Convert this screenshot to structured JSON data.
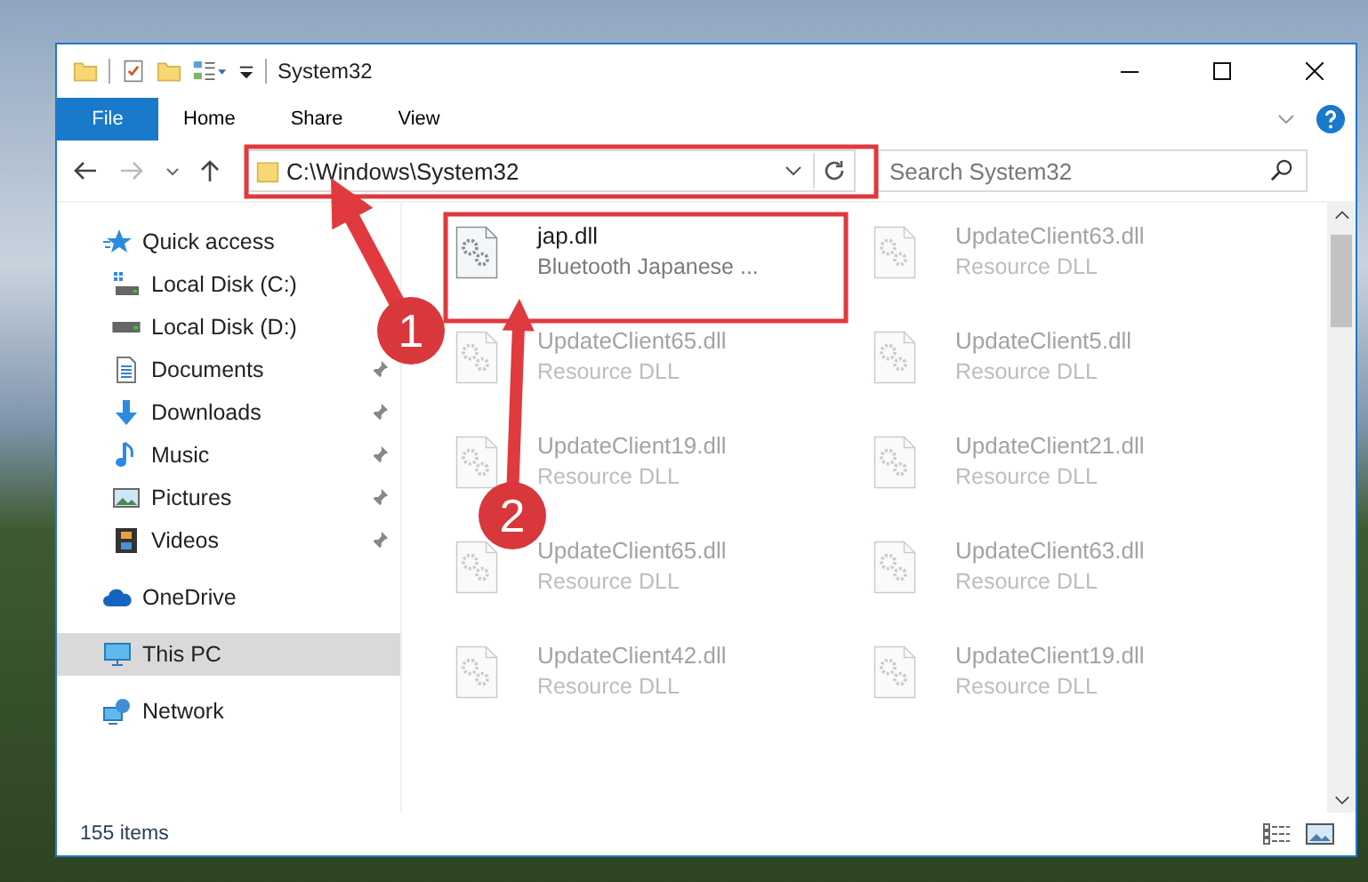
{
  "window": {
    "title": "System32"
  },
  "ribbon": {
    "file_tab": "File",
    "tabs": [
      {
        "label": "Home"
      },
      {
        "label": "Share"
      },
      {
        "label": "View"
      }
    ]
  },
  "address": {
    "path": "C:\\Windows\\System32"
  },
  "search": {
    "placeholder": "Search System32"
  },
  "sidebar": {
    "items": [
      {
        "label": "Quick access",
        "selected": false,
        "children": [
          {
            "label": "Local Disk (C:)",
            "selected": false,
            "pinned": false
          },
          {
            "label": "Local Disk (D:)",
            "selected": false,
            "pinned": false
          },
          {
            "label": "Documents",
            "selected": false,
            "pinned": true
          },
          {
            "label": "Downloads",
            "selected": false,
            "pinned": true
          },
          {
            "label": "Music",
            "selected": false,
            "pinned": true
          },
          {
            "label": "Pictures",
            "selected": false,
            "pinned": true
          },
          {
            "label": "Videos",
            "selected": false,
            "pinned": true
          }
        ]
      },
      {
        "label": "OneDrive",
        "selected": false
      },
      {
        "label": "This PC",
        "selected": true
      },
      {
        "label": "Network",
        "selected": false
      }
    ]
  },
  "files": [
    {
      "name": "jap.dll",
      "description": "Bluetooth Japanese ...",
      "blurred": false
    },
    {
      "name": "UpdateClient63.dll",
      "description": "Resource DLL",
      "blurred": true
    },
    {
      "name": "UpdateClient65.dll",
      "description": "Resource DLL",
      "blurred": true
    },
    {
      "name": "UpdateClient5.dll",
      "description": "Resource DLL",
      "blurred": true
    },
    {
      "name": "UpdateClient19.dll",
      "description": "Resource DLL",
      "blurred": true
    },
    {
      "name": "UpdateClient21.dll",
      "description": "Resource DLL",
      "blurred": true
    },
    {
      "name": "UpdateClient65.dll",
      "description": "Resource DLL",
      "blurred": true
    },
    {
      "name": "UpdateClient63.dll",
      "description": "Resource DLL",
      "blurred": true
    },
    {
      "name": "UpdateClient42.dll",
      "description": "Resource DLL",
      "blurred": true
    },
    {
      "name": "UpdateClient19.dll",
      "description": "Resource DLL",
      "blurred": true
    }
  ],
  "status_bar": {
    "count": "155 items"
  },
  "annotations": [
    {
      "label": "1"
    },
    {
      "label": "2"
    }
  ]
}
